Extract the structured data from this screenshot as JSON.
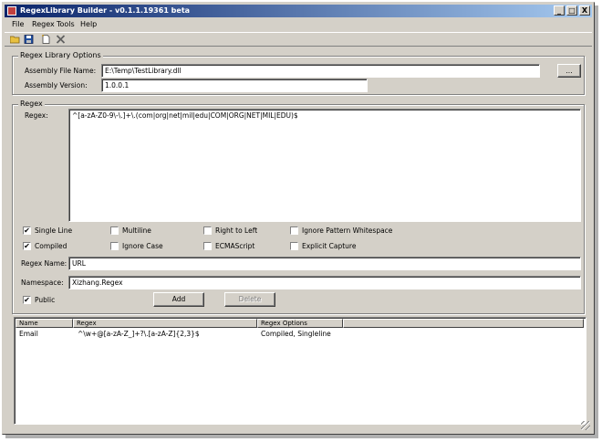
{
  "window": {
    "title": "RegexLibrary Builder - v0.1.1.19361 beta",
    "buttons": [
      "_",
      "□",
      "X"
    ]
  },
  "menu": [
    "File",
    "Regex",
    "Tools",
    "Help"
  ],
  "toolbar": {
    "icons": [
      "open-folder-icon",
      "save-icon",
      "new-document-icon",
      "delete-icon"
    ]
  },
  "library_options": {
    "group_label": "Regex Library Options",
    "assembly_file_label": "Assembly File Name:",
    "assembly_file_value": "E:\\Temp\\TestLibrary.dll",
    "browse_label": "...",
    "assembly_version_label": "Assembly Version:",
    "assembly_version_value": "1.0.0.1"
  },
  "regex": {
    "group_label": "Regex",
    "regex_label": "Regex:",
    "regex_value": "^[a-zA-Z0-9\\-\\.]+\\.(com|org|net|mil|edu|COM|ORG|NET|MIL|EDU)$",
    "options": {
      "single_line": {
        "label": "Single Line",
        "checked": true
      },
      "multiline": {
        "label": "Multiline",
        "checked": false
      },
      "right_to_left": {
        "label": "Right to Left",
        "checked": false
      },
      "ignore_pattern_whitespace": {
        "label": "Ignore Pattern Whitespace",
        "checked": false
      },
      "compiled": {
        "label": "Compiled",
        "checked": true
      },
      "ignore_case": {
        "label": "Ignore Case",
        "checked": false
      },
      "ecmascript": {
        "label": "ECMAScript",
        "checked": false
      },
      "explicit_capture": {
        "label": "Explicit Capture",
        "checked": false
      }
    },
    "name_label": "Regex Name:",
    "name_value": "URL",
    "namespace_label": "Namespace:",
    "namespace_value": "Xizhang.Regex",
    "public": {
      "label": "Public",
      "checked": true
    },
    "add_label": "Add",
    "delete_label": "Delete"
  },
  "list": {
    "columns": [
      "Name",
      "Regex",
      "Regex Options"
    ],
    "rows": [
      {
        "name": "Email",
        "regex": "^\\w+@[a-zA-Z_]+?\\.[a-zA-Z]{2,3}$",
        "options": "Compiled, Singleline"
      }
    ]
  }
}
